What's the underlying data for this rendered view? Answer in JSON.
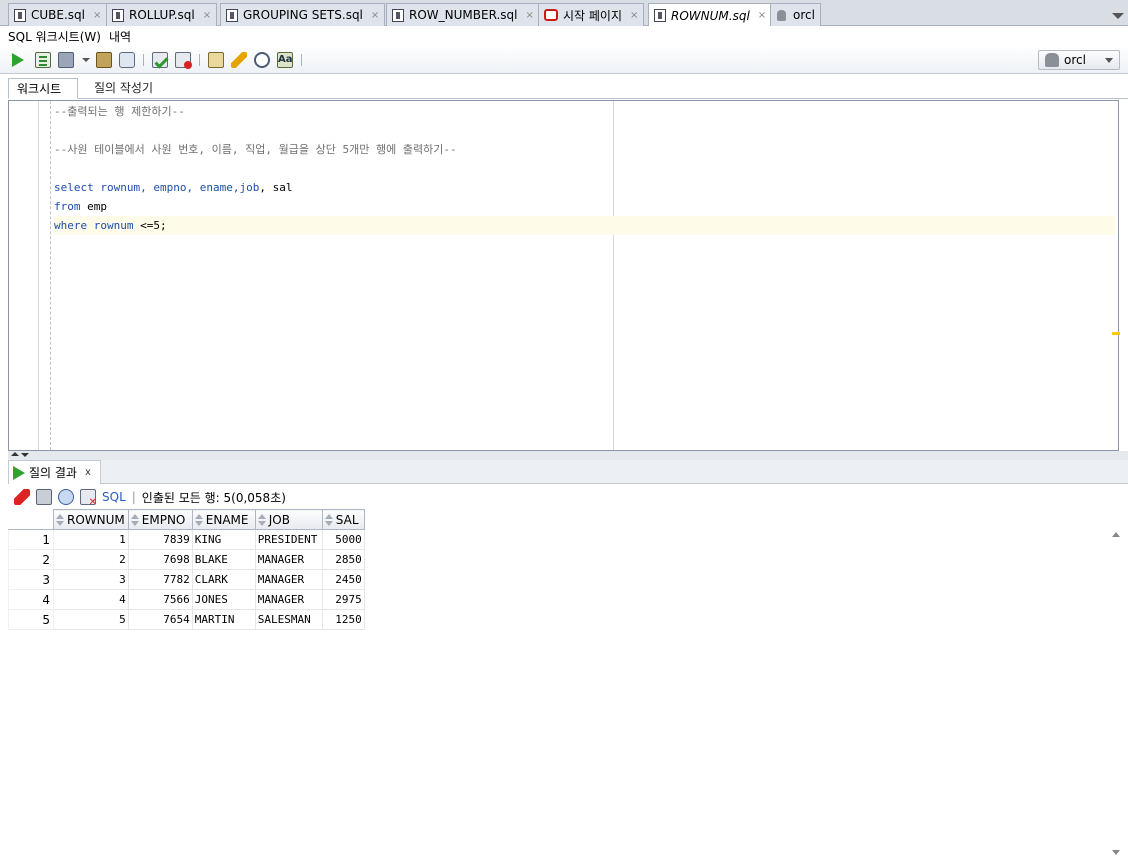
{
  "tabs": [
    {
      "label": "CUBE.sql",
      "icon": "sql-file-icon",
      "active": false
    },
    {
      "label": "ROLLUP.sql",
      "icon": "sql-file-icon",
      "active": false
    },
    {
      "label": "GROUPING SETS.sql",
      "icon": "sql-file-icon",
      "active": false
    },
    {
      "label": "ROW_NUMBER.sql",
      "icon": "sql-file-icon",
      "active": false
    },
    {
      "label": "시작 페이지",
      "icon": "oracle-icon",
      "active": false
    },
    {
      "label": "ROWNUM.sql",
      "icon": "sql-file-icon",
      "active": true
    },
    {
      "label": "orcl",
      "icon": "database-icon",
      "active": false
    }
  ],
  "tab_close": "×",
  "worksheet_menu": {
    "worksheet": "SQL 워크시트(W)",
    "history": "내역"
  },
  "connection": {
    "name": "orcl"
  },
  "worksheet_tabs": {
    "worksheet": "워크시트",
    "query_builder": "질의 작성기"
  },
  "editor": {
    "lines": [
      "--출력되는 행 제한하기--",
      "",
      "--사원 테이블에서 사원 번호, 이름, 직업, 월급을 상단 5개만 행에 출력하기--",
      "",
      "select rownum, empno, ename,job, sal",
      "from emp",
      "where rownum <=5;"
    ],
    "tokens": {
      "select": "select",
      "select_cols_1": " rownum, empno, ename,",
      "job": "job",
      "select_cols_2": ", sal",
      "from": "from",
      "from_rest": " emp",
      "where": "where",
      "rownum": "rownum",
      "where_rest": " <=5;"
    }
  },
  "results": {
    "tab_label": "질의 결과",
    "close": "x",
    "sql_link": "SQL",
    "separator": "|",
    "status": "인출된 모든 행: 5(0,058초)",
    "columns": [
      "ROWNUM",
      "EMPNO",
      "ENAME",
      "JOB",
      "SAL"
    ],
    "rows": [
      {
        "n": "1",
        "rownum": "1",
        "empno": "7839",
        "ename": "KING",
        "job": "PRESIDENT",
        "sal": "5000"
      },
      {
        "n": "2",
        "rownum": "2",
        "empno": "7698",
        "ename": "BLAKE",
        "job": "MANAGER",
        "sal": "2850"
      },
      {
        "n": "3",
        "rownum": "3",
        "empno": "7782",
        "ename": "CLARK",
        "job": "MANAGER",
        "sal": "2450"
      },
      {
        "n": "4",
        "rownum": "4",
        "empno": "7566",
        "ename": "JONES",
        "job": "MANAGER",
        "sal": "2975"
      },
      {
        "n": "5",
        "rownum": "5",
        "empno": "7654",
        "ename": "MARTIN",
        "job": "SALESMAN",
        "sal": "1250"
      }
    ]
  },
  "colors": {
    "keyword": "#1d4ea8",
    "comment": "#6f6f6f",
    "current_line": "#fefbe8",
    "run_green": "#2fa32f"
  }
}
